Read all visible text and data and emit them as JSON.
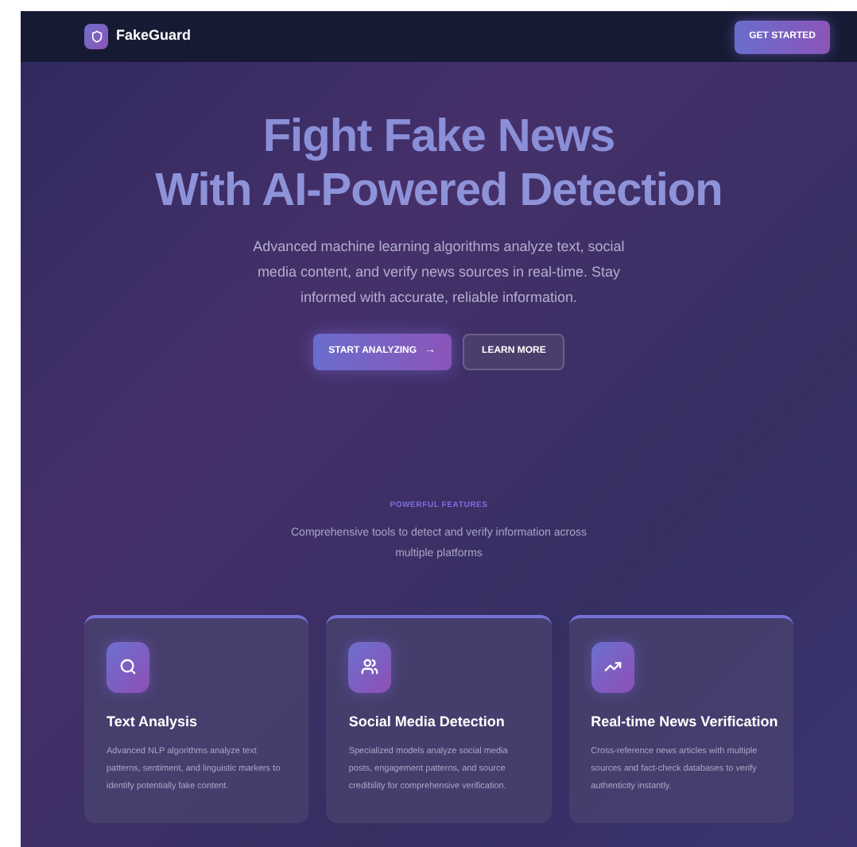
{
  "nav": {
    "brand": "FakeGuard",
    "cta": "GET STARTED"
  },
  "hero": {
    "title_line_1": "Fight Fake News",
    "title_line_2": "With AI-Powered Detection",
    "description": "Advanced machine learning algorithms analyze text, social media content, and verify news sources in real-time. Stay informed with accurate, reliable information.",
    "buttons": [
      {
        "label": "START ANALYZING",
        "kind": "primary",
        "arrow": "→"
      },
      {
        "label": "LEARN MORE",
        "kind": "secondary"
      }
    ]
  },
  "features": {
    "eyebrow": "POWERFUL FEATURES",
    "subtitle": "Comprehensive tools to detect and verify information across multiple platforms",
    "cards": [
      {
        "kind": "search",
        "title": "Text Analysis",
        "body": "Advanced NLP algorithms analyze text patterns, sentiment, and linguistic markers to identify potentially fake content."
      },
      {
        "kind": "users",
        "title": "Social Media Detection",
        "body": "Specialized models analyze social media posts, engagement patterns, and source credibility for comprehensive verification."
      },
      {
        "kind": "trend",
        "title": "Real-time News Verification",
        "body": "Cross-reference news articles with multiple sources and fact-check databases to verify authenticity instantly."
      }
    ]
  }
}
